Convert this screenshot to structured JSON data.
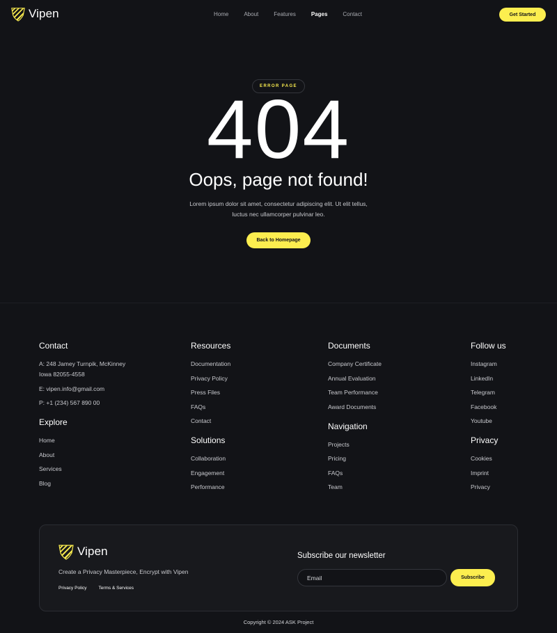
{
  "brand": {
    "name": "Vipen",
    "logo_icon": "shield-stripes-logo",
    "accent_color": "#fcee4f",
    "background_color": "#121317"
  },
  "nav": {
    "items": [
      {
        "label": "Home",
        "active": false
      },
      {
        "label": "About",
        "active": false
      },
      {
        "label": "Features",
        "active": false
      },
      {
        "label": "Pages",
        "active": true
      },
      {
        "label": "Contact",
        "active": false
      }
    ],
    "cta_label": "Get Started"
  },
  "hero": {
    "badge": "ERROR PAGE",
    "code": "404",
    "title": "Oops, page not found!",
    "description": "Lorem ipsum dolor sit amet, consectetur adipiscing elit. Ut elit tellus, luctus nec ullamcorper pulvinar leo.",
    "button_label": "Back to Homepage"
  },
  "footer": {
    "contact": {
      "title": "Contact",
      "address_line1": "A: 248 Jamey Turnpik, McKinney",
      "address_line2": "Iowa 82055-4558",
      "email": "E: vipen.info@gmail.com",
      "phone": "P: +1 (234) 567 890 00"
    },
    "explore": {
      "title": "Explore",
      "items": [
        "Home",
        "About",
        "Services",
        "Blog"
      ]
    },
    "resources": {
      "title": "Resources",
      "items": [
        "Documentation",
        "Privacy Policy",
        "Press Files",
        "FAQs",
        "Contact"
      ]
    },
    "solutions": {
      "title": "Solutions",
      "items": [
        "Collaboration",
        "Engagement",
        "Performance"
      ]
    },
    "documents": {
      "title": "Documents",
      "items": [
        "Company Certificate",
        "Annual Evaluation",
        "Team Performance",
        "Award Documents"
      ]
    },
    "navigation": {
      "title": "Navigation",
      "items": [
        "Projects",
        "Pricing",
        "FAQs",
        "Team"
      ]
    },
    "follow": {
      "title": "Follow us",
      "items": [
        "Instagram",
        "LinkedIn",
        "Telegram",
        "Facebook",
        "Youtube"
      ]
    },
    "privacy": {
      "title": "Privacy",
      "items": [
        "Cookies",
        "Imprint",
        "Privacy"
      ]
    }
  },
  "newsletter": {
    "brand_name": "Vipen",
    "tagline": "Create a Privacy Masterpiece, Encrypt with Vipen",
    "links": [
      "Privacy Policy",
      "Terms & Services"
    ],
    "title": "Subscribe our newsletter",
    "email_placeholder": "Email",
    "button_label": "Subscribe"
  },
  "copyright": "Copyright © 2024 ASK Project"
}
